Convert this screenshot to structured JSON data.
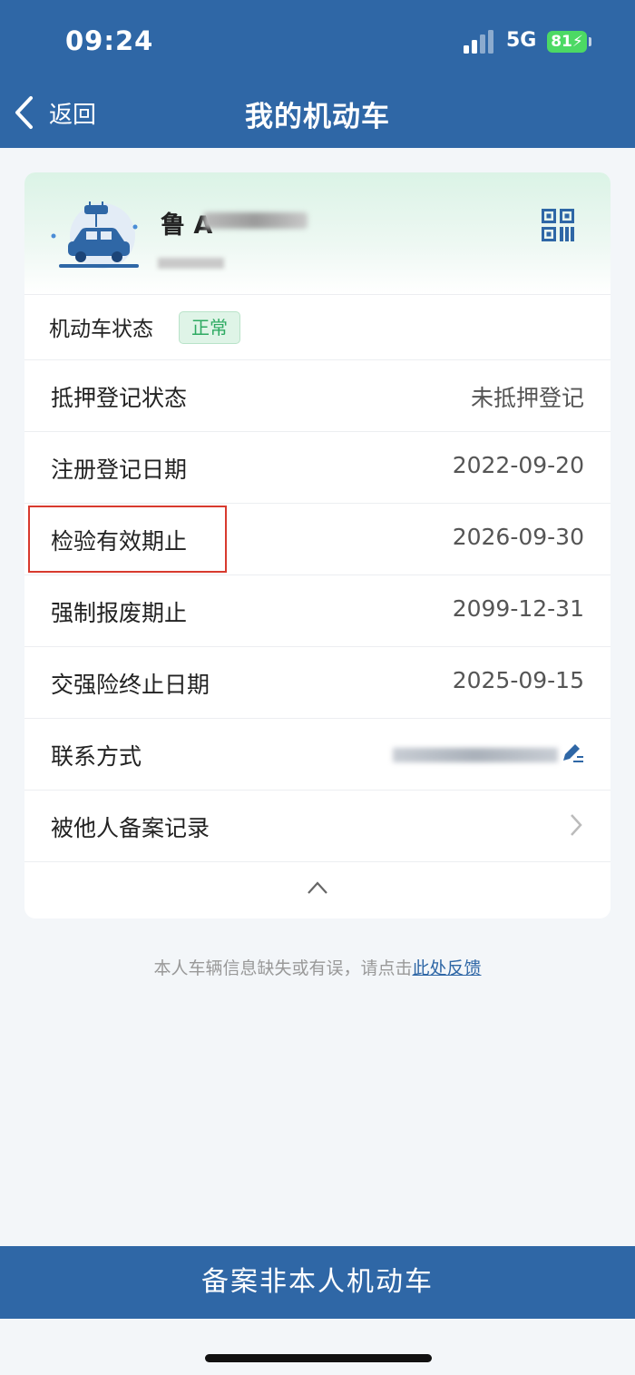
{
  "status_bar": {
    "time": "09:24",
    "network": "5G",
    "battery": "81"
  },
  "header": {
    "back_label": "返回",
    "title": "我的机动车"
  },
  "vehicle": {
    "plate_prefix": "鲁 A"
  },
  "status_row": {
    "label": "机动车状态",
    "badge": "正常"
  },
  "rows": [
    {
      "label": "抵押登记状态",
      "value": "未抵押登记"
    },
    {
      "label": "注册登记日期",
      "value": "2022-09-20"
    },
    {
      "label": "检验有效期止",
      "value": "2026-09-30"
    },
    {
      "label": "强制报废期止",
      "value": "2099-12-31"
    },
    {
      "label": "交强险终止日期",
      "value": "2025-09-15"
    }
  ],
  "contact_row": {
    "label": "联系方式"
  },
  "filing_row": {
    "label": "被他人备案记录"
  },
  "feedback": {
    "text": "本人车辆信息缺失或有误，请点击",
    "link": "此处反馈"
  },
  "bottom_button": {
    "label": "备案非本人机动车"
  },
  "colors": {
    "primary": "#2f67a6",
    "badge_green": "#2eaa62",
    "highlight_red": "#d83a2e"
  }
}
